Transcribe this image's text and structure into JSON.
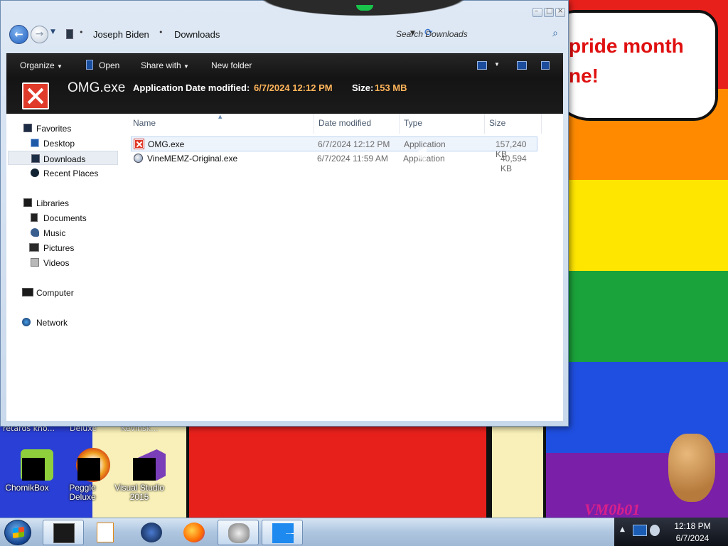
{
  "window": {
    "breadcrumbs": [
      "Joseph Biden",
      "Downloads"
    ],
    "search_placeholder": "Search Downloads",
    "toolbar": {
      "organize": "Organize",
      "open": "Open",
      "share_with": "Share with",
      "new_folder": "New folder"
    },
    "details": {
      "name": "OMG.exe",
      "type": "Application",
      "date_modified_label": "Date modified:",
      "date_modified_value": "6/7/2024 12:12 PM",
      "size_label": "Size:",
      "size_value": "153 MB"
    },
    "nav": {
      "favorites": "Favorites",
      "desktop": "Desktop",
      "downloads": "Downloads",
      "recent_places": "Recent Places",
      "libraries": "Libraries",
      "documents": "Documents",
      "music": "Music",
      "pictures": "Pictures",
      "videos": "Videos",
      "computer": "Computer",
      "network": "Network"
    },
    "columns": {
      "name": "Name",
      "date_modified": "Date modified",
      "type": "Type",
      "size": "Size"
    },
    "files": [
      {
        "name": "OMG.exe",
        "date": "6/7/2024 12:12 PM",
        "type": "Application",
        "size": "157,240 KB",
        "icon": "error-x-icon",
        "selected": true
      },
      {
        "name": "VineMEMZ-Original.exe",
        "date": "6/7/2024 11:59 AM",
        "type": "Application",
        "size": "40,594 KB",
        "icon": "vinememz-icon",
        "selected": false
      }
    ]
  },
  "desktop": {
    "banner_text": "pride month\nne!",
    "watermark": "VM0b01",
    "cut_labels": [
      "retards kno...",
      "Deluxe",
      "Kevinsk..."
    ],
    "icons": [
      {
        "label": "ChomikBox"
      },
      {
        "label": "Peggle Deluxe"
      },
      {
        "label": "Visual Studio 2015"
      }
    ]
  },
  "taskbar": {
    "clock_time": "12:18 PM",
    "clock_date": "6/7/2024"
  },
  "colors": {
    "accent_orange": "#ffb45a",
    "pride": [
      "#e8201c",
      "#ff8a00",
      "#ffe600",
      "#1aa33a",
      "#1f4fe0",
      "#7a1fa8"
    ]
  }
}
